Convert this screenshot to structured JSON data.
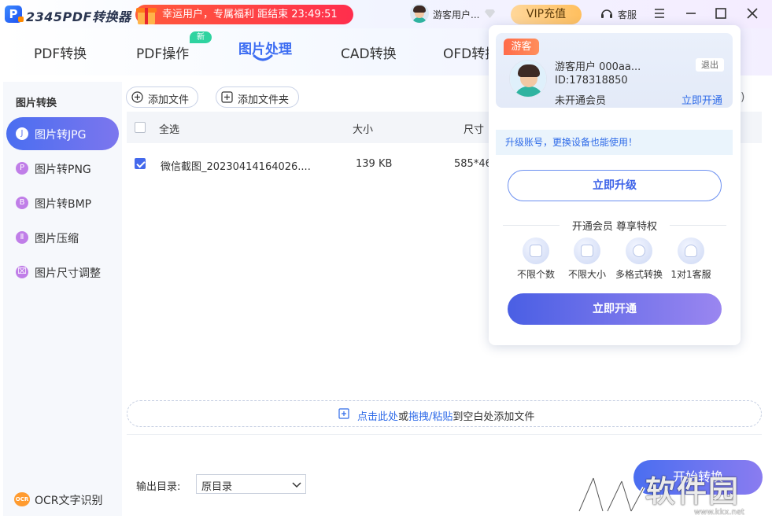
{
  "app": {
    "name": "2345PDF转换器",
    "promo": "幸运用户，专属福利 距结束 23:49:51",
    "user_short": "游客用户...",
    "vip_label": "VIP充值",
    "service_label": "客服"
  },
  "tabs": [
    {
      "label": "PDF转换"
    },
    {
      "label": "PDF操作",
      "badge": "新"
    },
    {
      "label": "图片处理"
    },
    {
      "label": "CAD转换"
    },
    {
      "label": "OFD转换"
    }
  ],
  "sidebar": {
    "heading": "图片转换",
    "items": [
      {
        "label": "图片转JPG",
        "icon_char": "J"
      },
      {
        "label": "图片转PNG",
        "icon_char": "P"
      },
      {
        "label": "图片转BMP",
        "icon_char": "B"
      },
      {
        "label": "图片压缩",
        "icon_char": "Ⅱ"
      },
      {
        "label": "图片尺寸调整",
        "icon_char": "⌧"
      }
    ],
    "ocr_icon_text": "OCR",
    "ocr_label": "OCR文字识别"
  },
  "toolbar": {
    "add_file": "添加文件",
    "add_folder": "添加文件夹"
  },
  "table": {
    "headers": {
      "select_all": "全选",
      "size": "大小",
      "dimension": "尺寸"
    },
    "rows": [
      {
        "checked": true,
        "name": "微信截图_20230414164026....",
        "size": "139 KB",
        "dimension": "585*46"
      }
    ]
  },
  "dropzone": {
    "part1": "点击此处",
    "part2": "或",
    "part3": "拖拽/粘贴",
    "part4": "到空白处添加文件"
  },
  "output": {
    "label": "输出目录:",
    "value": "原目录"
  },
  "start_button": "开始转换",
  "watermark": {
    "text": "软件园",
    "url": "www.kkx.net"
  },
  "hidden_paren": ")",
  "popup": {
    "badge": "游客",
    "name": "游客用户  000aa...",
    "id": "ID:178318850",
    "status": "未开通会员",
    "logout": "退出",
    "open_link": "立即开通",
    "upgrade_tip": "升级账号，更换设备也能使用！",
    "upgrade_button": "立即升级",
    "perk_title": "开通会员 尊享特权",
    "perks": [
      "不限个数",
      "不限大小",
      "多格式转换",
      "1对1客服"
    ],
    "open_button": "立即开通"
  },
  "colors": {
    "accent": "#4a6ef0",
    "link": "#2f6be8",
    "promo": "#ff3b47",
    "vip": "#ffc766"
  }
}
